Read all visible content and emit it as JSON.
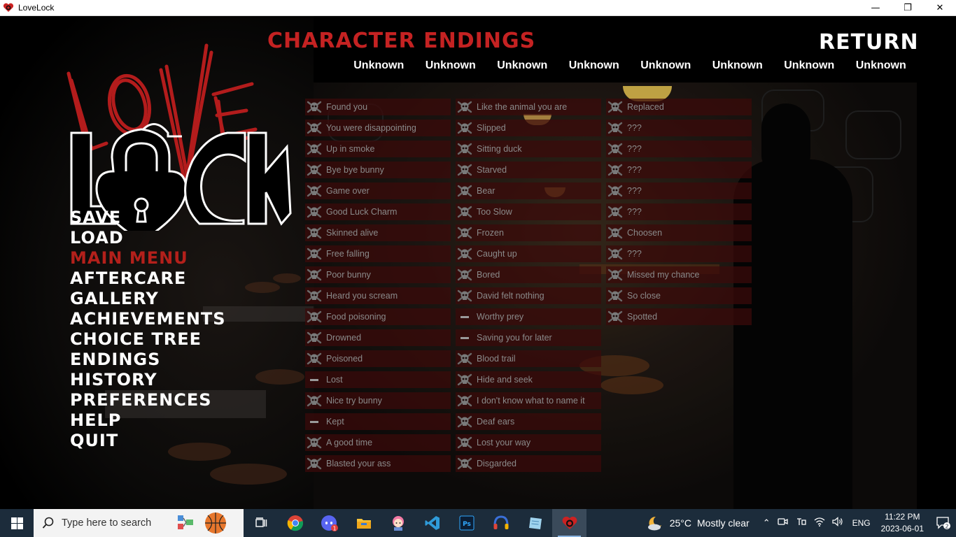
{
  "window": {
    "title": "LoveLock",
    "minimize": "—",
    "maximize": "❐",
    "close": "✕"
  },
  "logo": {
    "word_top": "LoVE",
    "word_bottom": "LoCk"
  },
  "menu": [
    {
      "label": "SAVE",
      "active": false
    },
    {
      "label": "LOAD",
      "active": false
    },
    {
      "label": "MAIN MENU",
      "active": true
    },
    {
      "label": "AFTERCARE",
      "active": false
    },
    {
      "label": "GALLERY",
      "active": false
    },
    {
      "label": "ACHIEVEMENTS",
      "active": false
    },
    {
      "label": "CHOICE TREE",
      "active": false
    },
    {
      "label": "ENDINGS",
      "active": false
    },
    {
      "label": "HISTORY",
      "active": false
    },
    {
      "label": "PREFERENCES",
      "active": false
    },
    {
      "label": "HELP",
      "active": false
    },
    {
      "label": "QUIT",
      "active": false
    }
  ],
  "heading": "CHARACTER ENDINGS",
  "return_label": "RETURN",
  "tabs": [
    "Unknown",
    "Unknown",
    "Unknown",
    "Unknown",
    "Unknown",
    "Unknown",
    "Unknown",
    "Unknown"
  ],
  "endings": {
    "col1": [
      {
        "label": "Found you",
        "icon": "skull-crossbones-icon"
      },
      {
        "label": "You were disappointing",
        "icon": "skull-crossbones-icon"
      },
      {
        "label": "Up in smoke",
        "icon": "skull-crossbones-icon"
      },
      {
        "label": "Bye bye bunny",
        "icon": "skull-crossbones-icon"
      },
      {
        "label": "Game over",
        "icon": "skull-crossbones-icon"
      },
      {
        "label": "Good Luck Charm",
        "icon": "skull-crossbones-icon"
      },
      {
        "label": "Skinned alive",
        "icon": "skull-crossbones-icon"
      },
      {
        "label": "Free falling",
        "icon": "skull-crossbones-icon"
      },
      {
        "label": "Poor bunny",
        "icon": "skull-crossbones-icon"
      },
      {
        "label": "Heard you scream",
        "icon": "skull-crossbones-icon"
      },
      {
        "label": "Food poisoning",
        "icon": "skull-crossbones-icon"
      },
      {
        "label": "Drowned",
        "icon": "skull-crossbones-icon"
      },
      {
        "label": "Poisoned",
        "icon": "skull-crossbones-icon"
      },
      {
        "label": "Lost",
        "icon": "dash-icon"
      },
      {
        "label": "Nice try bunny",
        "icon": "skull-crossbones-icon"
      },
      {
        "label": "Kept",
        "icon": "dash-icon"
      },
      {
        "label": "A good time",
        "icon": "skull-crossbones-icon"
      },
      {
        "label": "Blasted your ass",
        "icon": "skull-crossbones-icon"
      }
    ],
    "col2": [
      {
        "label": "Like the animal you are",
        "icon": "skull-crossbones-icon"
      },
      {
        "label": "Slipped",
        "icon": "skull-crossbones-icon"
      },
      {
        "label": "Sitting duck",
        "icon": "skull-crossbones-icon"
      },
      {
        "label": "Starved",
        "icon": "skull-crossbones-icon"
      },
      {
        "label": "Bear",
        "icon": "skull-crossbones-icon"
      },
      {
        "label": "Too Slow",
        "icon": "skull-crossbones-icon"
      },
      {
        "label": "Frozen",
        "icon": "skull-crossbones-icon"
      },
      {
        "label": "Caught up",
        "icon": "skull-crossbones-icon"
      },
      {
        "label": "Bored",
        "icon": "skull-crossbones-icon"
      },
      {
        "label": "David felt nothing",
        "icon": "skull-crossbones-icon"
      },
      {
        "label": "Worthy prey",
        "icon": "dash-icon"
      },
      {
        "label": "Saving you for later",
        "icon": "dash-icon"
      },
      {
        "label": "Blood trail",
        "icon": "skull-crossbones-icon"
      },
      {
        "label": "Hide and seek",
        "icon": "skull-crossbones-icon"
      },
      {
        "label": "I don't know what to name it",
        "icon": "skull-crossbones-icon"
      },
      {
        "label": "Deaf ears",
        "icon": "skull-crossbones-icon"
      },
      {
        "label": "Lost your way",
        "icon": "skull-crossbones-icon"
      },
      {
        "label": "Disgarded",
        "icon": "skull-crossbones-icon"
      }
    ],
    "col3": [
      {
        "label": "Replaced",
        "icon": "skull-crossbones-icon"
      },
      {
        "label": "???",
        "icon": "skull-crossbones-icon"
      },
      {
        "label": "???",
        "icon": "skull-crossbones-icon"
      },
      {
        "label": "???",
        "icon": "skull-crossbones-icon"
      },
      {
        "label": "???",
        "icon": "skull-crossbones-icon"
      },
      {
        "label": "???",
        "icon": "skull-crossbones-icon"
      },
      {
        "label": "Choosen",
        "icon": "skull-crossbones-icon"
      },
      {
        "label": "???",
        "icon": "skull-crossbones-icon"
      },
      {
        "label": "Missed my chance",
        "icon": "skull-crossbones-icon"
      },
      {
        "label": "So close",
        "icon": "skull-crossbones-icon"
      },
      {
        "label": "Spotted",
        "icon": "skull-crossbones-icon"
      }
    ]
  },
  "taskbar": {
    "search_placeholder": "Type here to search",
    "apps": [
      "task-view-icon",
      "chrome-icon",
      "discord-icon",
      "file-explorer-icon",
      "anime-app-icon",
      "vscode-icon",
      "photoshop-icon",
      "headset-app-icon",
      "notes-app-icon",
      "lovelock-app-icon"
    ],
    "discord_badge": "1",
    "weather_temp": "25°C",
    "weather_desc": "Mostly clear",
    "language": "ENG",
    "time": "11:22 PM",
    "date": "2023-06-01",
    "notification_count": "2"
  },
  "colors": {
    "accent_red": "#c42222",
    "menu_active": "#b3201b",
    "taskbar_bg": "#1c2c3b"
  }
}
